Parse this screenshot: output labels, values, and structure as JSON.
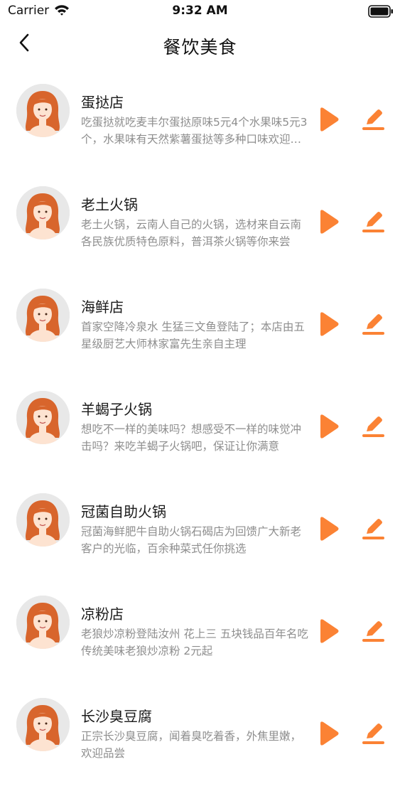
{
  "status_bar": {
    "carrier": "Carrier",
    "time": "9:32 AM"
  },
  "nav": {
    "title": "餐饮美食"
  },
  "colors": {
    "accent": "#fb8234",
    "avatar_hair": "#d8652c",
    "avatar_skin": "#fde3d1",
    "avatar_bg": "#e8e8e8"
  },
  "icons": {
    "back": "chevron-left-icon",
    "play": "play-icon",
    "edit": "edit-icon"
  },
  "items": [
    {
      "title": "蛋挞店",
      "desc": "吃蛋挞就吃麦丰尔蛋挞原味5元4个水果味5元3个，水果味有天然紫薯蛋挞等多种口味欢迎品尝"
    },
    {
      "title": "老土火锅",
      "desc": "老土火锅，云南人自己的火锅，选材来自云南各民族优质特色原料，普洱茶火锅等你来尝"
    },
    {
      "title": "海鲜店",
      "desc": "首家空降冷泉水 生猛三文鱼登陆了；本店由五星级厨艺大师林家富先生亲自主理"
    },
    {
      "title": "羊蝎子火锅",
      "desc": "想吃不一样的美味吗？想感受不一样的味觉冲击吗？来吃羊蝎子火锅吧，保证让你满意"
    },
    {
      "title": "冠菌自助火锅",
      "desc": "冠菌海鲜肥牛自助火锅石碣店为回馈广大新老客户的光临，百余种菜式任你挑选"
    },
    {
      "title": "凉粉店",
      "desc": "老狼炒凉粉登陆汝州 花上三 五块钱品百年名吃 传统美味老狼炒凉粉 2元起"
    },
    {
      "title": "长沙臭豆腐",
      "desc": "正宗长沙臭豆腐，闻着臭吃着香，外焦里嫩，欢迎品尝"
    }
  ]
}
